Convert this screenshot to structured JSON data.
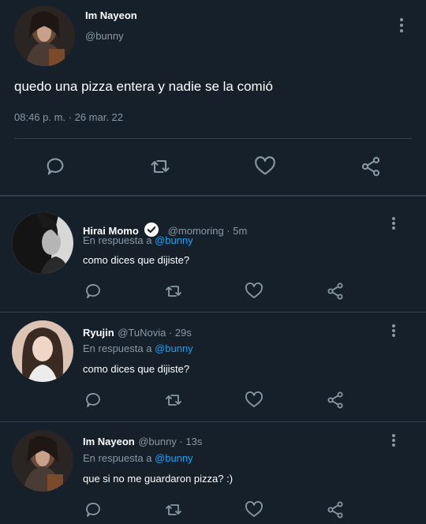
{
  "main_tweet": {
    "name": "Im Nayeon",
    "handle": "@bunny",
    "text": "quedo una pizza entera y nadie se la comió",
    "timestamp": "08:46 p. m. · 26 mar. 22",
    "actions": [
      "reply-icon",
      "retweet-icon",
      "like-icon",
      "share-icon"
    ]
  },
  "replies": [
    {
      "name": "Hirai Momo",
      "verified": true,
      "handle_time": "@momoring · 5m",
      "reply_prefix": "En respuesta a ",
      "reply_to": "@bunny",
      "text": "como dices que dijiste?"
    },
    {
      "name": "Ryujin",
      "verified": false,
      "handle_time": "@TuNovia · 29s",
      "reply_prefix": "En respuesta a ",
      "reply_to": "@bunny",
      "text": "como dices que dijiste?"
    },
    {
      "name": "Im Nayeon",
      "verified": false,
      "handle_time": "@bunny · 13s",
      "reply_prefix": "En respuesta a ",
      "reply_to": "@bunny",
      "text": "que si no me guardaron pizza? :)"
    }
  ],
  "colors": {
    "background": "#15202b",
    "muted": "#8899a6",
    "link": "#1da1f2",
    "divider": "#2f3f4f"
  }
}
